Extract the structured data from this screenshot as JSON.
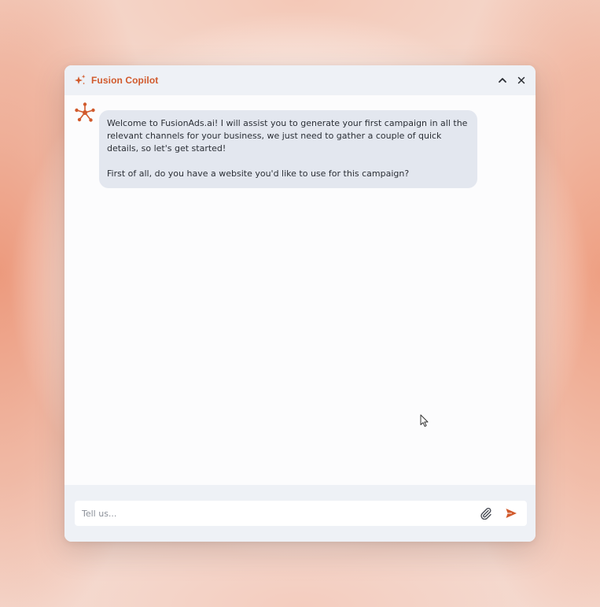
{
  "header": {
    "title": "Fusion Copilot",
    "title_icon": "sparkle-icon",
    "actions": [
      "collapse-icon",
      "close-icon"
    ]
  },
  "conversation": {
    "messages": [
      {
        "sender": "bot",
        "avatar_icon": "network-node-icon",
        "paragraphs": [
          "Welcome to FusionAds.ai! I will assist you to generate your first campaign in all the relevant channels for your business, we just need to gather a couple of quick details, so let's get started!",
          "First of all, do you have a website you'd like to use for this campaign?"
        ]
      }
    ]
  },
  "composer": {
    "placeholder": "Tell us...",
    "value": "",
    "attach_icon": "paperclip-icon",
    "send_icon": "send-icon"
  },
  "colors": {
    "accent": "#d15a2c",
    "header_bg": "#eef1f6",
    "bubble_bg": "#e3e7ef",
    "panel_bg": "#fcfcfd",
    "backdrop_warm": "#ec9678"
  }
}
